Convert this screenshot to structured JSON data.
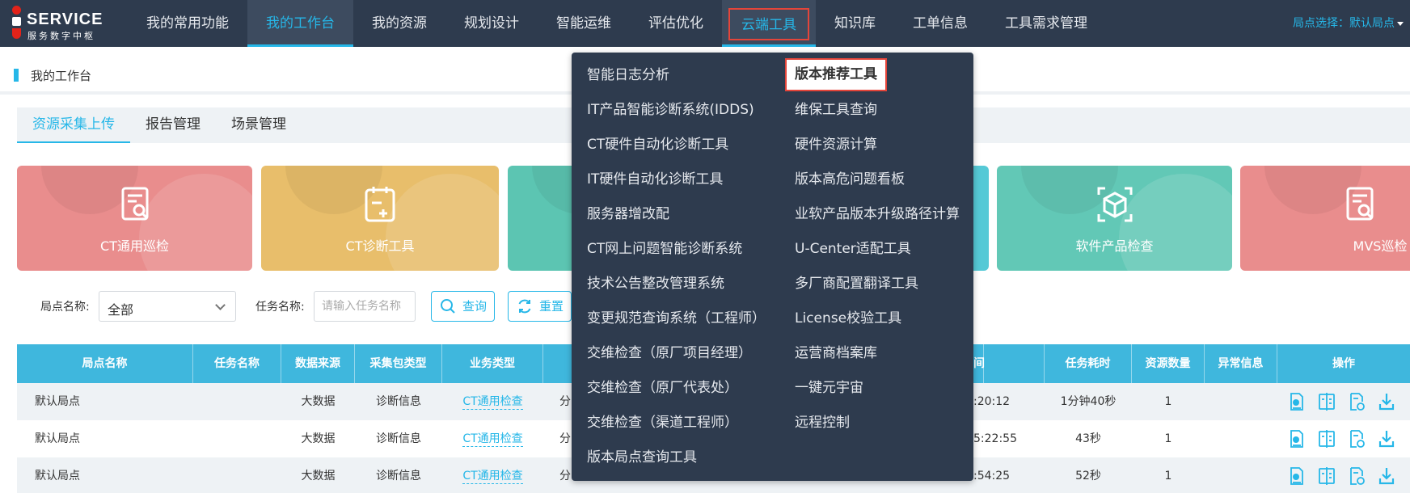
{
  "logo": {
    "name": "SERVICE",
    "sub": "服务数字中枢"
  },
  "nav": {
    "items": [
      "我的常用功能",
      "我的工作台",
      "我的资源",
      "规划设计",
      "智能运维",
      "评估优化",
      "云端工具",
      "知识库",
      "工单信息",
      "工具需求管理"
    ],
    "site_select": "局点选择：默认局点"
  },
  "breadcrumb": "我的工作台",
  "tabs": [
    "资源采集上传",
    "报告管理",
    "场景管理"
  ],
  "cards": [
    {
      "label": "CT通用巡检",
      "color": "#e98d8d",
      "icon": "report-search-icon"
    },
    {
      "label": "CT诊断工具",
      "color": "#e8be6b",
      "icon": "clipboard-add-icon"
    },
    {
      "label": "",
      "color": "#5cc5b2",
      "icon": ""
    },
    {
      "label": "",
      "color": "#55c9d6",
      "icon": ""
    },
    {
      "label": "软件产品检查",
      "color": "#62c8b6",
      "icon": "cube-icon"
    },
    {
      "label": "MVS巡检",
      "color": "#e98d8d",
      "icon": "report-search-icon"
    }
  ],
  "filter": {
    "site_label": "局点名称:",
    "site_value": "全部",
    "task_label": "任务名称:",
    "task_placeholder": "请输入任务名称",
    "query": "查询",
    "reset": "重置"
  },
  "table": {
    "headers": [
      "局点名称",
      "任务名称",
      "数据来源",
      "采集包类型",
      "业务类型",
      "",
      "间",
      "任务耗时",
      "资源数量",
      "异常信息",
      "操作"
    ],
    "rows": [
      {
        "site": "默认局点",
        "task": "",
        "source": "大数据",
        "pkg": "诊断信息",
        "biz": "CT通用检查",
        "cut": "分",
        "time": ":20:12",
        "dur": "1分钟40秒",
        "count": "1"
      },
      {
        "site": "默认局点",
        "task": "",
        "source": "大数据",
        "pkg": "诊断信息",
        "biz": "CT通用检查",
        "cut": "分",
        "time": "5:22:55",
        "dur": "43秒",
        "count": "1"
      },
      {
        "site": "默认局点",
        "task": "",
        "source": "大数据",
        "pkg": "诊断信息",
        "biz": "CT通用检查",
        "cut": "分",
        "time": ":54:25",
        "dur": "52秒",
        "count": "1"
      }
    ]
  },
  "menu": {
    "col1": [
      "智能日志分析",
      "IT产品智能诊断系统(IDDS)",
      "CT硬件自动化诊断工具",
      "IT硬件自动化诊断工具",
      "服务器增改配",
      "CT网上问题智能诊断系统",
      "技术公告整改管理系统",
      "变更规范查询系统（工程师）",
      "交维检查（原厂项目经理）",
      "交维检查（原厂代表处）",
      "交维检查（渠道工程师）",
      "版本局点查询工具"
    ],
    "col2": [
      "版本推荐工具",
      "维保工具查询",
      "硬件资源计算",
      "版本高危问题看板",
      "业软产品版本升级路径计算",
      "U-Center适配工具",
      "多厂商配置翻译工具",
      "License校验工具",
      "运营商档案库",
      "一键元宇宙",
      "远程控制"
    ]
  },
  "colors": {
    "accent": "#26b7e8",
    "nav_bg": "#2e3b4e",
    "highlight_border": "#e4453a",
    "table_header": "#3fb7dd"
  }
}
